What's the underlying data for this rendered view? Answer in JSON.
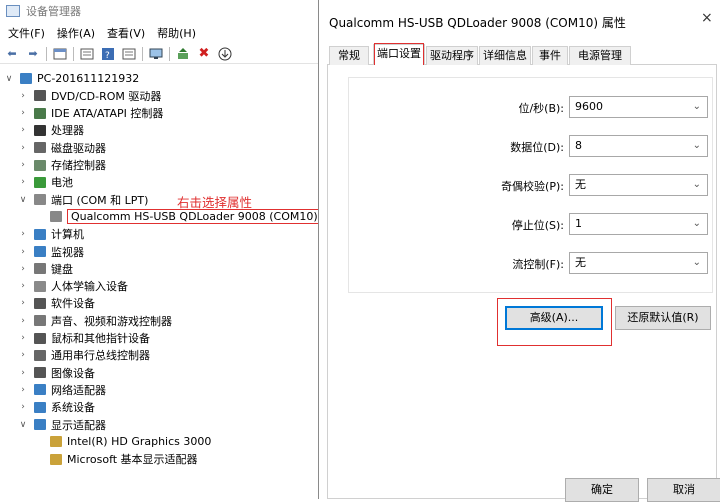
{
  "device_manager": {
    "title": "设备管理器",
    "menu": [
      "文件(F)",
      "操作(A)",
      "查看(V)",
      "帮助(H)"
    ],
    "root": "PC-201611121932",
    "categories": [
      {
        "label": "DVD/CD-ROM 驱动器",
        "icon": "dvd-icon",
        "expanded": false
      },
      {
        "label": "IDE ATA/ATAPI 控制器",
        "icon": "ide-icon",
        "expanded": false
      },
      {
        "label": "处理器",
        "icon": "cpu-icon",
        "expanded": false
      },
      {
        "label": "磁盘驱动器",
        "icon": "disk-icon",
        "expanded": false
      },
      {
        "label": "存储控制器",
        "icon": "storage-icon",
        "expanded": false
      },
      {
        "label": "电池",
        "icon": "battery-icon",
        "expanded": false
      },
      {
        "label": "端口 (COM 和 LPT)",
        "icon": "port-icon",
        "expanded": true
      },
      {
        "label": "计算机",
        "icon": "computer-icon",
        "expanded": false
      },
      {
        "label": "监视器",
        "icon": "monitor-icon",
        "expanded": false
      },
      {
        "label": "键盘",
        "icon": "keyboard-icon",
        "expanded": false
      },
      {
        "label": "人体学输入设备",
        "icon": "hid-icon",
        "expanded": false
      },
      {
        "label": "软件设备",
        "icon": "software-icon",
        "expanded": false
      },
      {
        "label": "声音、视频和游戏控制器",
        "icon": "sound-icon",
        "expanded": false
      },
      {
        "label": "鼠标和其他指针设备",
        "icon": "mouse-icon",
        "expanded": false
      },
      {
        "label": "通用串行总线控制器",
        "icon": "usb-icon",
        "expanded": false
      },
      {
        "label": "图像设备",
        "icon": "camera-icon",
        "expanded": false
      },
      {
        "label": "网络适配器",
        "icon": "network-icon",
        "expanded": false
      },
      {
        "label": "系统设备",
        "icon": "system-icon",
        "expanded": false
      },
      {
        "label": "显示适配器",
        "icon": "display-icon",
        "expanded": true
      }
    ],
    "port_child": "Qualcomm HS-USB QDLoader 9008 (COM10)",
    "display_children": [
      "Intel(R) HD Graphics 3000",
      "Microsoft 基本显示适配器"
    ],
    "annotation": "右击选择属性"
  },
  "dialog": {
    "title": "Qualcomm HS-USB QDLoader 9008 (COM10) 属性",
    "close": "×",
    "tabs": [
      "常规",
      "端口设置",
      "驱动程序",
      "详细信息",
      "事件",
      "电源管理"
    ],
    "active_tab": "端口设置",
    "fields": [
      {
        "label": "位/秒(B):",
        "value": "9600"
      },
      {
        "label": "数据位(D):",
        "value": "8"
      },
      {
        "label": "奇偶校验(P):",
        "value": "无"
      },
      {
        "label": "停止位(S):",
        "value": "1"
      },
      {
        "label": "流控制(F):",
        "value": "无"
      }
    ],
    "advanced_button": "高级(A)...",
    "restore_button": "还原默认值(R)",
    "ok_button": "确定",
    "cancel_button": "取消"
  },
  "colors": {
    "accent": "#0078d7",
    "annotation": "#e03030"
  }
}
